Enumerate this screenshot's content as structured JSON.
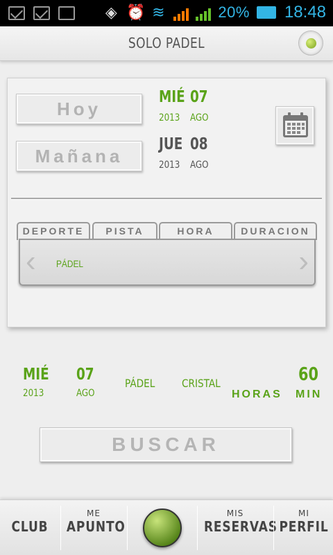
{
  "status": {
    "battery_pct": "20%",
    "time": "18:48"
  },
  "header": {
    "title": "SOLO PADEL"
  },
  "day_buttons": {
    "today": "Hoy",
    "tomorrow": "Mañana"
  },
  "dates": {
    "today": {
      "dow": "MIÉ",
      "day": "07",
      "year": "2013",
      "month": "AGO"
    },
    "tomorrow": {
      "dow": "JUE",
      "day": "08",
      "year": "2013",
      "month": "AGO"
    }
  },
  "tabs": [
    "DEPORTE",
    "PISTA",
    "HORA",
    "DURACION"
  ],
  "selector": {
    "value": "PÁDEL"
  },
  "summary": {
    "dow": "MIÉ",
    "year": "2013",
    "day": "07",
    "month": "AGO",
    "sport": "PÁDEL",
    "court": "CRISTAL",
    "hours_label": "HORAS",
    "minutes": "60",
    "min_label": "MIN"
  },
  "search": {
    "label": "BUSCAR"
  },
  "nav": {
    "club": "CLUB",
    "apunto": {
      "top": "ME",
      "bottom": "APUNTO"
    },
    "reservas": {
      "top": "MIS",
      "bottom": "RESERVAS"
    },
    "perfil": {
      "top": "MI",
      "bottom": "PERFIL"
    }
  },
  "colors": {
    "accent": "#5aa319",
    "status": "#33b5e5"
  }
}
